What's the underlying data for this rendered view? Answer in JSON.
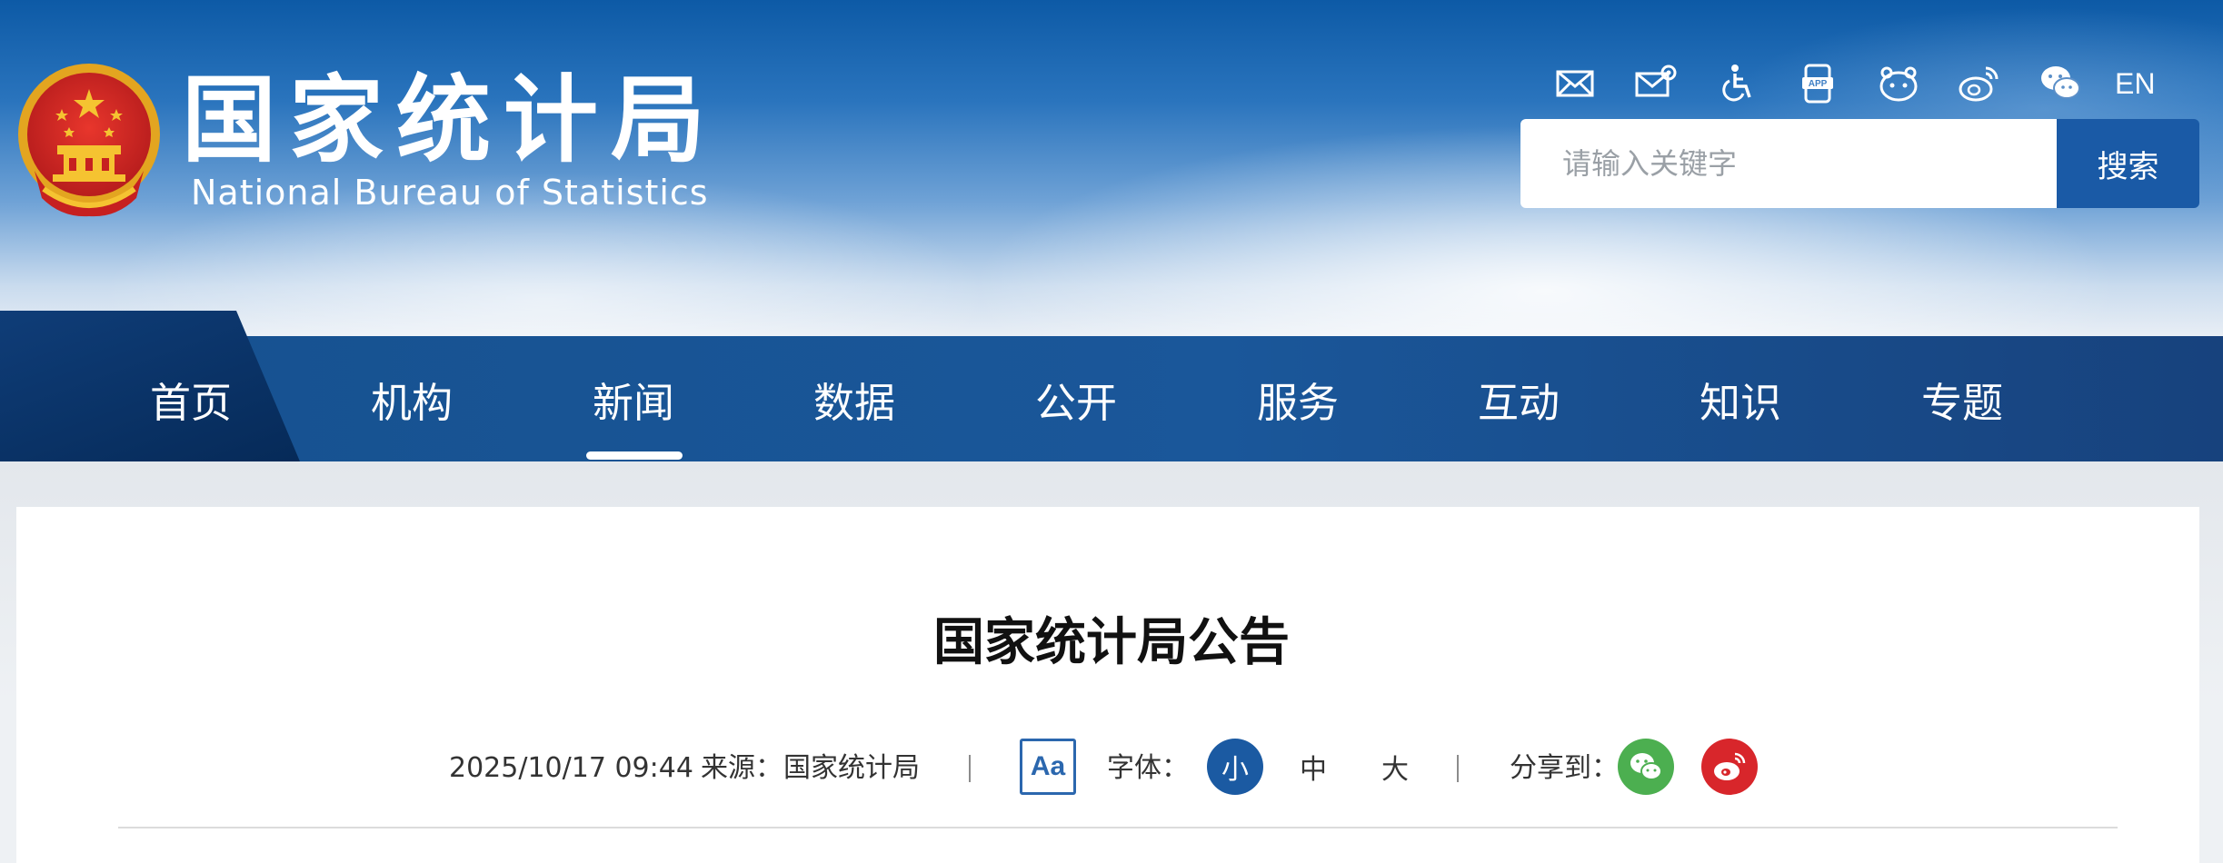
{
  "header": {
    "site_name_cn": "国家统计局",
    "site_name_en": "National Bureau of Statistics",
    "tools": [
      {
        "icon": "mail-icon"
      },
      {
        "icon": "mail-settings-icon"
      },
      {
        "icon": "accessibility-icon"
      },
      {
        "icon": "app-icon"
      },
      {
        "icon": "mini-program-icon"
      },
      {
        "icon": "weibo-icon"
      },
      {
        "icon": "wechat-icon"
      }
    ],
    "lang_label": "EN",
    "search": {
      "placeholder": "请输入关键字",
      "button_label": "搜索"
    }
  },
  "nav": {
    "items": [
      {
        "label": "首页"
      },
      {
        "label": "机构"
      },
      {
        "label": "新闻"
      },
      {
        "label": "数据"
      },
      {
        "label": "公开"
      },
      {
        "label": "服务"
      },
      {
        "label": "互动"
      },
      {
        "label": "知识"
      },
      {
        "label": "专题"
      }
    ],
    "active_index": 2
  },
  "article": {
    "title": "国家统计局公告",
    "datetime": "2025/10/17 09:44",
    "source_label": "来源：",
    "source": "国家统计局",
    "aa_label": "Aa",
    "font_label": "字体：",
    "font_sizes": [
      "小",
      "中",
      "大"
    ],
    "font_size_selected": "小",
    "share_label": "分享到："
  },
  "colors": {
    "nav_bg": "#1a579a",
    "accent": "#1b5aa2",
    "wechat_green": "#4caf50",
    "weibo_red": "#d8262b"
  }
}
